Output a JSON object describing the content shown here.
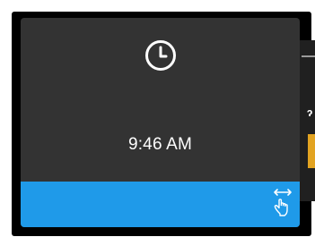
{
  "time": {
    "value": "9:46 AM"
  },
  "icons": {
    "clock": "clock-icon",
    "swipe": "swipe-gesture-icon"
  },
  "colors": {
    "card_background": "#333333",
    "action_bar": "#1f9ae9",
    "text": "#ffffff",
    "background_accent": "#e2a321"
  }
}
